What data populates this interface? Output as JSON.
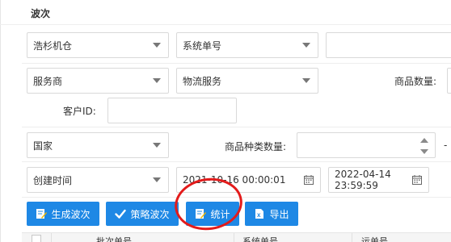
{
  "section": {
    "title": "波次"
  },
  "filters": {
    "row1": {
      "warehouse_select": "浩杉机仓",
      "number_type_select": "系统单号",
      "number_input": ""
    },
    "row2": {
      "carrier_select": "服务商",
      "service_select": "物流服务",
      "product_qty_label": "商品数量:",
      "product_qty_input": ""
    },
    "row3": {
      "customer_id_label": "客户ID:",
      "customer_id_input": ""
    },
    "row4": {
      "country_select": "国家",
      "sku_kind_qty_label": "商品种类数量:",
      "sku_kind_qty_input": "",
      "range_dash": "-"
    },
    "row5": {
      "time_type_select": "创建时间",
      "start_time": "2021-10-16 00:00:01",
      "end_time": "2022-04-14 23:59:59"
    }
  },
  "actions": {
    "generate_wave": "生成波次",
    "strategy_wave": "策略波次",
    "statistics": "统计",
    "export": "导出"
  },
  "table": {
    "headers": [
      "批次单号",
      "系统单号",
      "运单号"
    ]
  },
  "colors": {
    "primary": "#1e88e5",
    "highlight_circle": "#e31b1b"
  }
}
